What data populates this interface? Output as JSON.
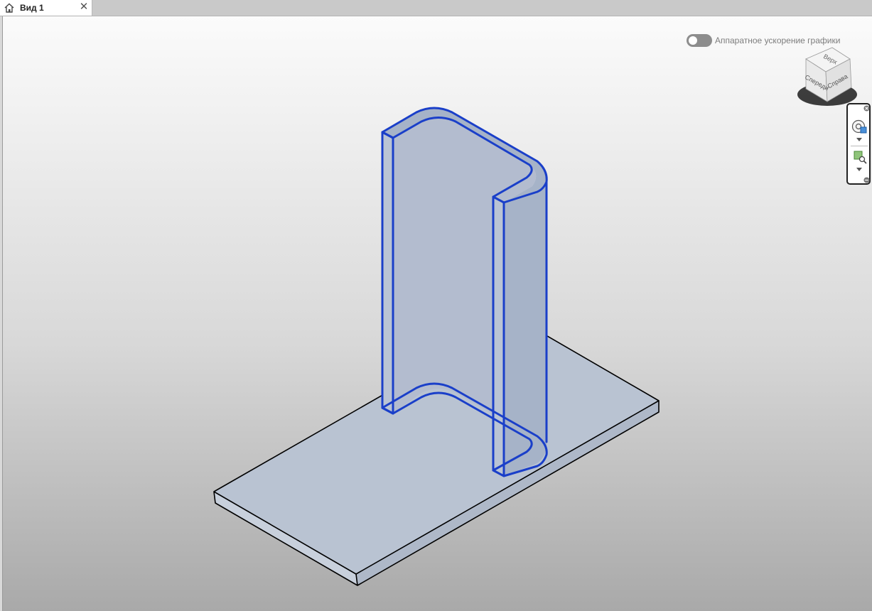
{
  "tab": {
    "label": "Вид 1",
    "close_glyph": "✕"
  },
  "hardware_acceleration": {
    "label": "Аппаратное ускорение графики",
    "enabled": false
  },
  "viewcube": {
    "top": "Верх",
    "front": "Спереди",
    "right": "Справа"
  },
  "icons": {
    "tab": "home-icon",
    "close": "close-icon",
    "wheel": "steering-wheel-icon",
    "zoom": "zoom-region-icon"
  },
  "colors": {
    "selection": "#1a3fc9",
    "face": "#b9c3d2",
    "edge": "#000000",
    "viewport_top": "#fbfbfb",
    "viewport_bottom": "#a9a9a9"
  }
}
